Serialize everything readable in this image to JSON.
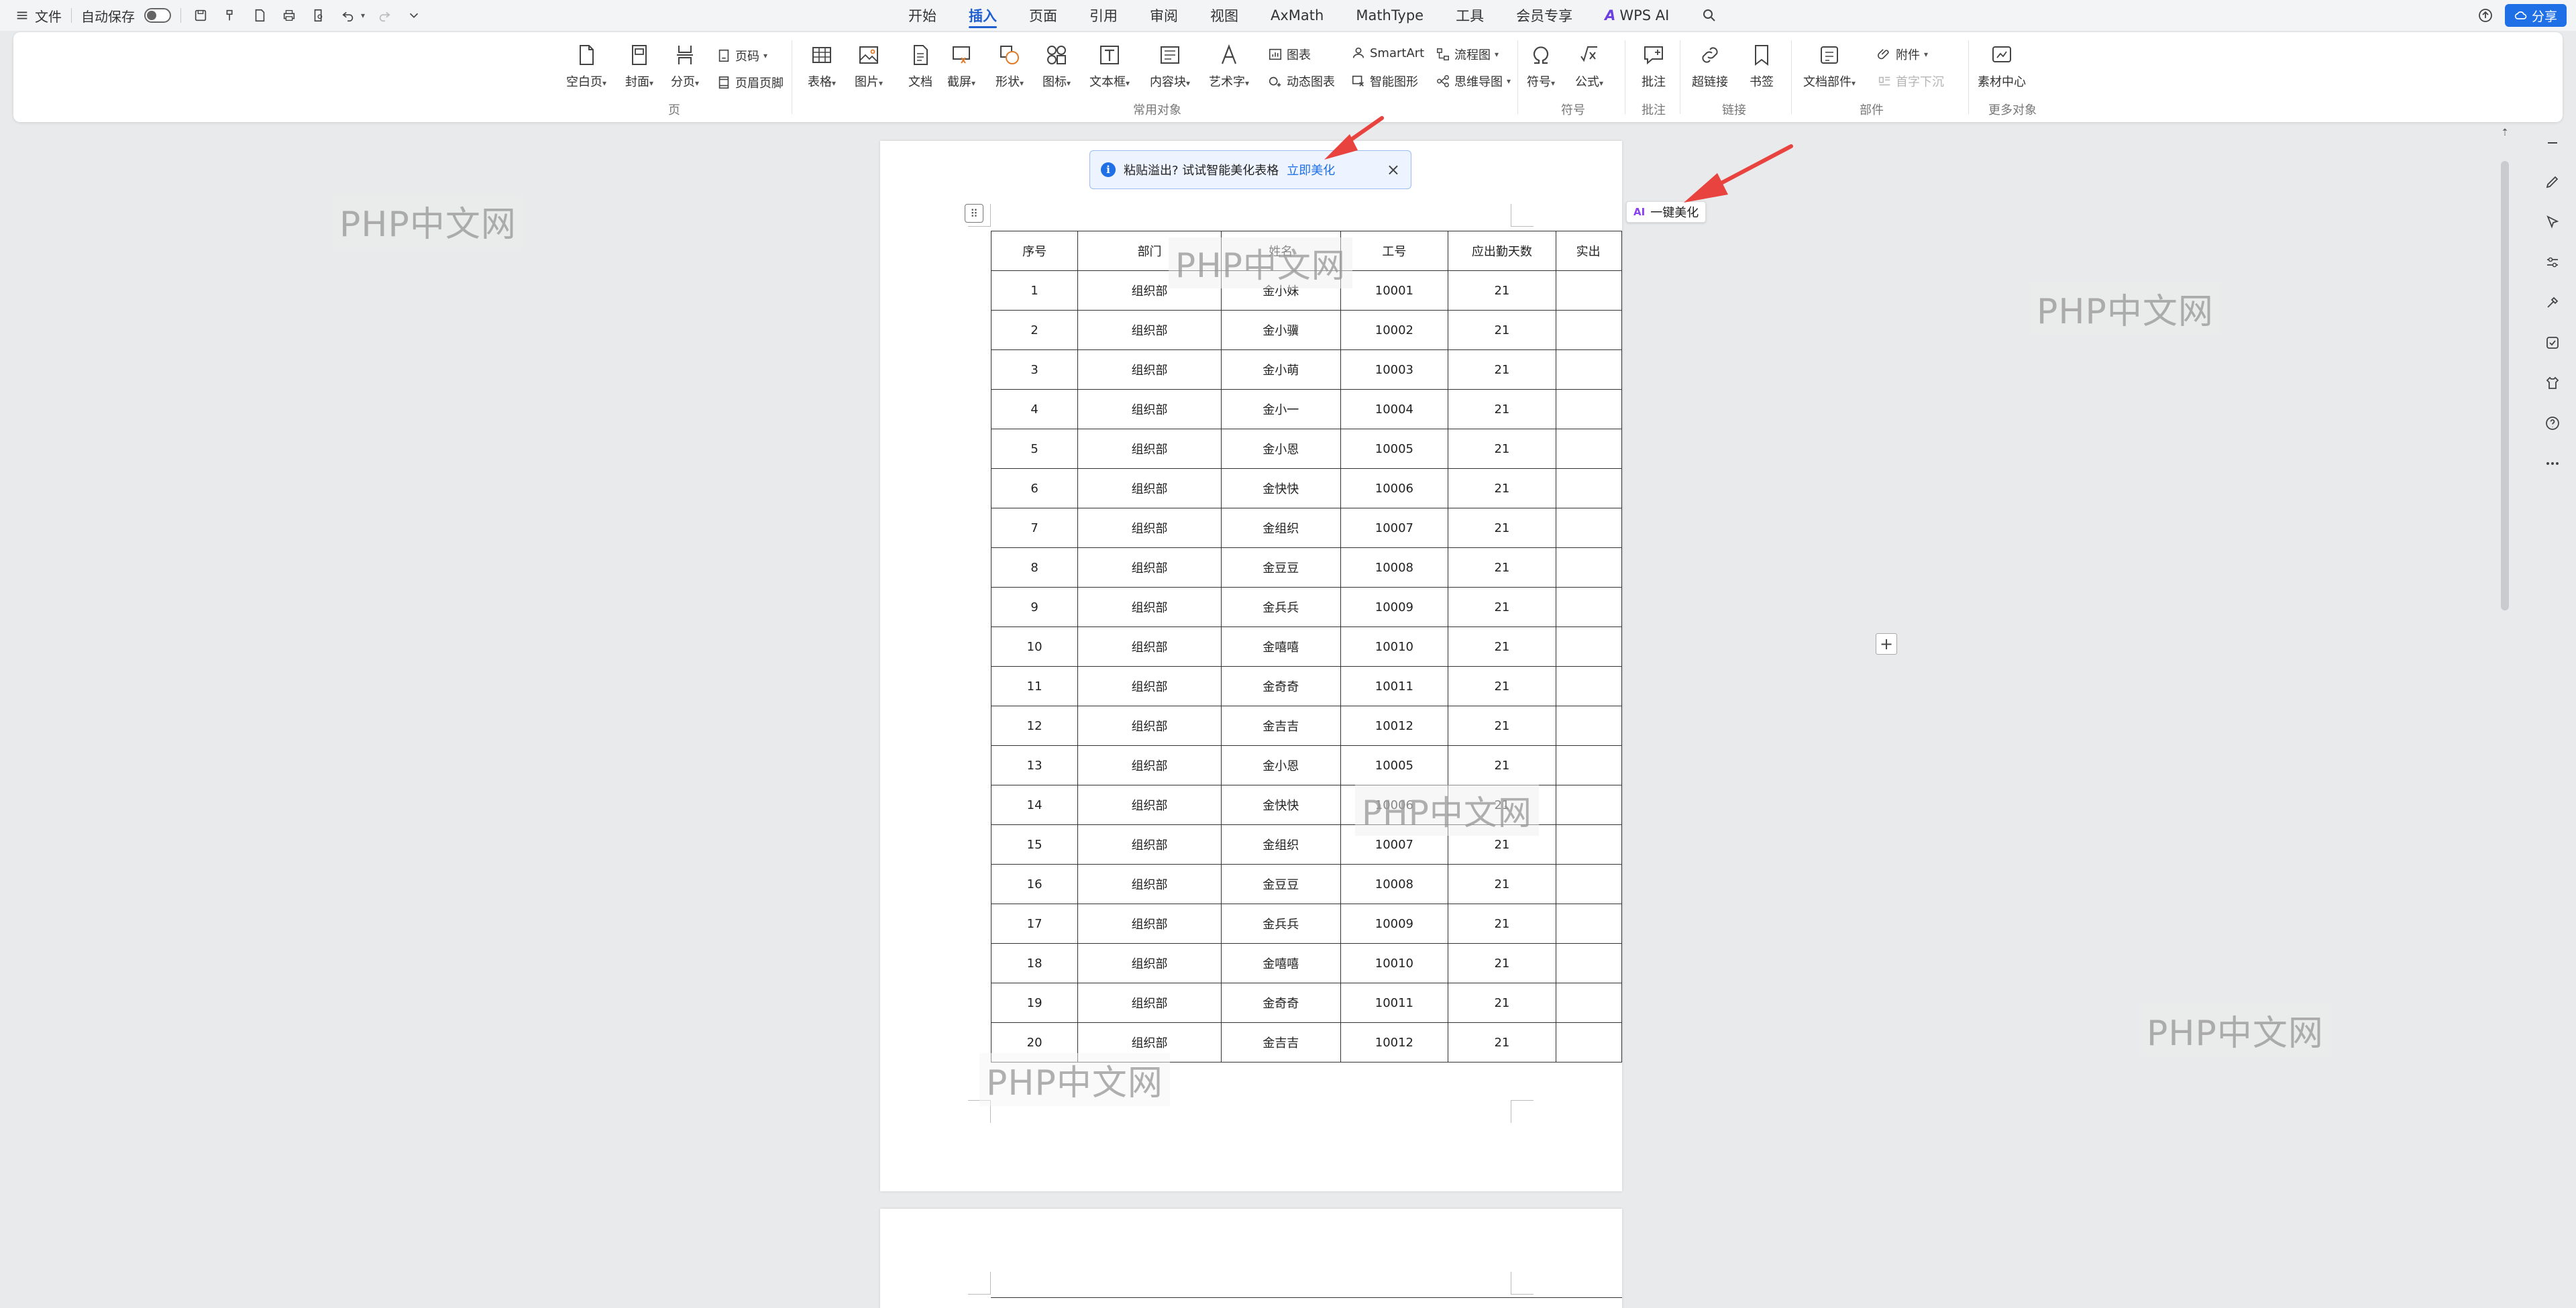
{
  "titlebar": {
    "file_label": "文件",
    "autosave_label": "自动保存",
    "tabs": [
      {
        "label": "开始",
        "active": false
      },
      {
        "label": "插入",
        "active": true
      },
      {
        "label": "页面",
        "active": false
      },
      {
        "label": "引用",
        "active": false
      },
      {
        "label": "审阅",
        "active": false
      },
      {
        "label": "视图",
        "active": false
      },
      {
        "label": "AxMath",
        "active": false
      },
      {
        "label": "MathType",
        "active": false
      },
      {
        "label": "工具",
        "active": false
      },
      {
        "label": "会员专享",
        "active": false
      },
      {
        "label": "WPS AI",
        "active": false
      }
    ],
    "share_label": "分享"
  },
  "ribbon": {
    "page_group": {
      "label": "页",
      "blank_page": "空白页",
      "cover": "封面",
      "page_break": "分页",
      "page_number": "页码",
      "header_footer": "页眉页脚"
    },
    "common_group": {
      "label": "常用对象",
      "table": "表格",
      "picture": "图片",
      "document": "文档",
      "screenshot": "截屏",
      "shape": "形状",
      "icon": "图标",
      "textbox": "文本框",
      "content_block": "内容块",
      "wordart": "艺术字",
      "chart": "图表",
      "smartart": "SmartArt",
      "flowchart": "流程图",
      "dynamic_chart": "动态图表",
      "smart_shape": "智能图形",
      "mindmap": "思维导图"
    },
    "symbol_group": {
      "label": "符号",
      "symbol": "符号",
      "formula": "公式"
    },
    "comment_group": {
      "label": "批注",
      "comment": "批注"
    },
    "link_group": {
      "label": "链接",
      "hyperlink": "超链接",
      "bookmark": "书签"
    },
    "parts_group": {
      "label": "部件",
      "doc_parts": "文档部件",
      "attachment": "附件",
      "drop_cap": "首字下沉"
    },
    "more_group": {
      "label": "更多对象",
      "material_center": "素材中心"
    }
  },
  "notice": {
    "text": "粘贴溢出? 试试智能美化表格",
    "action": "立即美化"
  },
  "ai_beautify": {
    "badge": "AI",
    "label": "一键美化"
  },
  "table": {
    "headers": [
      "序号",
      "部门",
      "姓名",
      "工号",
      "应出勤天数",
      "实出"
    ],
    "rows": [
      [
        "1",
        "组织部",
        "金小妹",
        "10001",
        "21",
        ""
      ],
      [
        "2",
        "组织部",
        "金小骥",
        "10002",
        "21",
        ""
      ],
      [
        "3",
        "组织部",
        "金小萌",
        "10003",
        "21",
        ""
      ],
      [
        "4",
        "组织部",
        "金小一",
        "10004",
        "21",
        ""
      ],
      [
        "5",
        "组织部",
        "金小恩",
        "10005",
        "21",
        ""
      ],
      [
        "6",
        "组织部",
        "金快快",
        "10006",
        "21",
        ""
      ],
      [
        "7",
        "组织部",
        "金组织",
        "10007",
        "21",
        ""
      ],
      [
        "8",
        "组织部",
        "金豆豆",
        "10008",
        "21",
        ""
      ],
      [
        "9",
        "组织部",
        "金兵兵",
        "10009",
        "21",
        ""
      ],
      [
        "10",
        "组织部",
        "金嘻嘻",
        "10010",
        "21",
        ""
      ],
      [
        "11",
        "组织部",
        "金奇奇",
        "10011",
        "21",
        ""
      ],
      [
        "12",
        "组织部",
        "金吉吉",
        "10012",
        "21",
        ""
      ],
      [
        "13",
        "组织部",
        "金小恩",
        "10005",
        "21",
        ""
      ],
      [
        "14",
        "组织部",
        "金快快",
        "10006",
        "21",
        ""
      ],
      [
        "15",
        "组织部",
        "金组织",
        "10007",
        "21",
        ""
      ],
      [
        "16",
        "组织部",
        "金豆豆",
        "10008",
        "21",
        ""
      ],
      [
        "17",
        "组织部",
        "金兵兵",
        "10009",
        "21",
        ""
      ],
      [
        "18",
        "组织部",
        "金嘻嘻",
        "10010",
        "21",
        ""
      ],
      [
        "19",
        "组织部",
        "金奇奇",
        "10011",
        "21",
        ""
      ],
      [
        "20",
        "组织部",
        "金吉吉",
        "10012",
        "21",
        ""
      ]
    ]
  },
  "watermarks": [
    "PHP中文网",
    "PHP中文网",
    "PHP中文网",
    "PHP中文网",
    "PHP中文网",
    "PHP中文网"
  ],
  "colors": {
    "accent": "#1f5fd0",
    "arrow": "#e8433f",
    "ai": "#8a3ff0"
  }
}
